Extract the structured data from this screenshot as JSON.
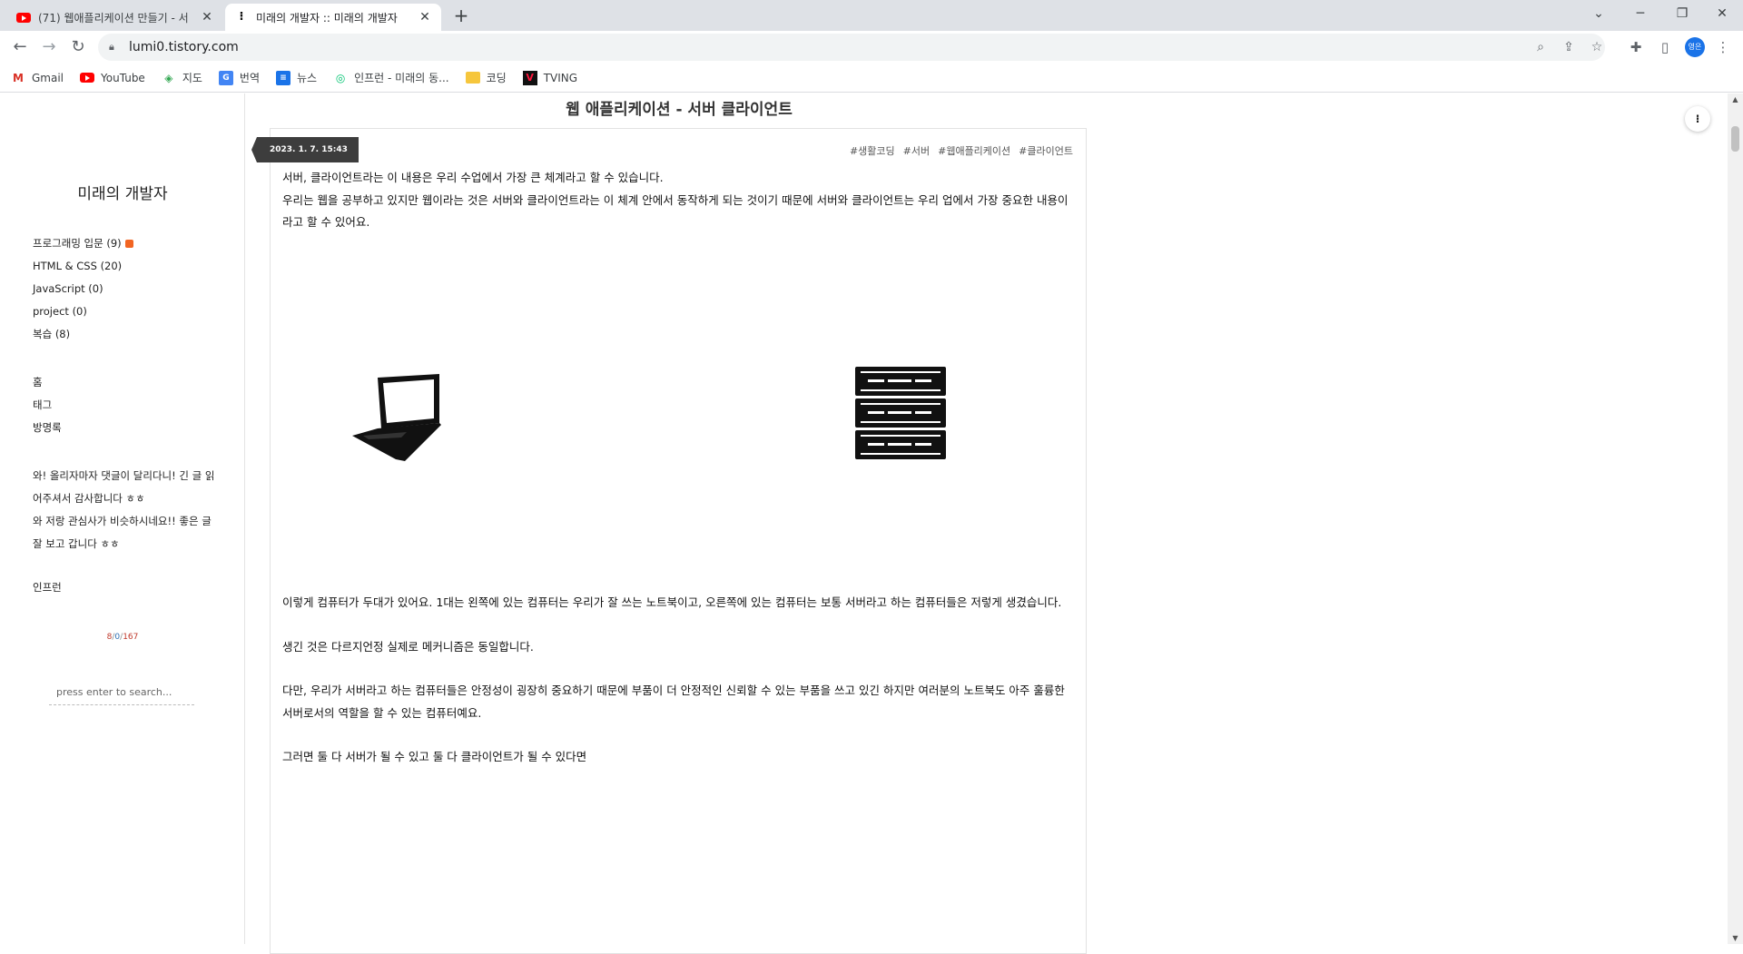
{
  "browser": {
    "tabs": [
      {
        "title": "(71) 웹애플리케이션 만들기 - 서",
        "favicon": "youtube-icon",
        "active": false
      },
      {
        "title": "미래의 개발자 :: 미래의 개발자",
        "favicon": "tistory-icon",
        "active": true
      }
    ],
    "url": "lumi0.tistory.com",
    "profile_initials": "영은",
    "bookmarks": [
      {
        "label": "Gmail",
        "icon": "gmail-icon"
      },
      {
        "label": "YouTube",
        "icon": "youtube-icon"
      },
      {
        "label": "지도",
        "icon": "maps-icon"
      },
      {
        "label": "번역",
        "icon": "translate-icon"
      },
      {
        "label": "뉴스",
        "icon": "news-icon"
      },
      {
        "label": "인프런 - 미래의 동...",
        "icon": "inflearn-icon"
      },
      {
        "label": "코딩",
        "icon": "folder-icon"
      },
      {
        "label": "TVING",
        "icon": "tving-icon"
      }
    ]
  },
  "sidebar": {
    "blog_title": "미래의 개발자",
    "categories": [
      {
        "label": "프로그래밍 입문 (9)",
        "new": true
      },
      {
        "label": "HTML & CSS (20)",
        "new": false
      },
      {
        "label": "JavaScript (0)",
        "new": false
      },
      {
        "label": "project (0)",
        "new": false
      },
      {
        "label": "복습 (8)",
        "new": false
      }
    ],
    "menu": [
      "홈",
      "태그",
      "방명록"
    ],
    "recent_comments": [
      "와! 올리자마자 댓글이 달리다니! 긴 글 읽어주셔서 감사합니다 ㅎㅎ",
      "와 저랑 관심사가 비슷하시네요!! 좋은 글 잘 보고 갑니다 ㅎㅎ"
    ],
    "link": "인프런",
    "counter": {
      "today": "8",
      "yesterday": "0",
      "total": "167"
    },
    "search_placeholder": "press enter to search..."
  },
  "post": {
    "title": "웹 애플리케이션 - 서버 클라이언트",
    "date": "2023. 1. 7. 15:43",
    "tags": [
      "#생활코딩",
      "#서버",
      "#웹애플리케이션",
      "#클라이언트"
    ],
    "paragraphs_top": [
      "서버, 클라이언트라는 이 내용은 우리 수업에서 가장 큰 체계라고 할 수 있습니다.",
      "우리는 웹을 공부하고 있지만 웹이라는 것은 서버와 클라이언트라는 이 체계 안에서 동작하게 되는 것이기 때문에 서버와 클라이언트는 우리 업에서 가장 중요한 내용이라고 할 수 있어요."
    ],
    "figure_icons": [
      "laptop-icon",
      "server-icon"
    ],
    "paragraphs_bottom": [
      "이렇게 컴퓨터가 두대가 있어요. 1대는 왼쪽에 있는 컴퓨터는 우리가 잘 쓰는 노트북이고, 오른쪽에 있는 컴퓨터는 보통 서버라고 하는 컴퓨터들은 저렇게 생겼습니다.",
      "생긴 것은 다르지언정 실제로 메커니즘은 동일합니다.",
      "다만, 우리가 서버라고 하는 컴퓨터들은 안정성이 굉장히 중요하기 때문에 부품이 더 안정적인 신뢰할 수 있는 부품을 쓰고 있긴 하지만 여러분의 노트북도 아주 훌륭한 서버로서의 역할을 할 수 있는 컴퓨터예요.",
      "그러면 둘 다 서버가 될 수 있고 둘 다 클라이언트가 될 수 있다면"
    ]
  },
  "colors": {
    "date_flag": "#3d3d3d",
    "rss": "#f26522",
    "counter_today": "#c0392b",
    "counter_yesterday": "#2c6fb3"
  }
}
